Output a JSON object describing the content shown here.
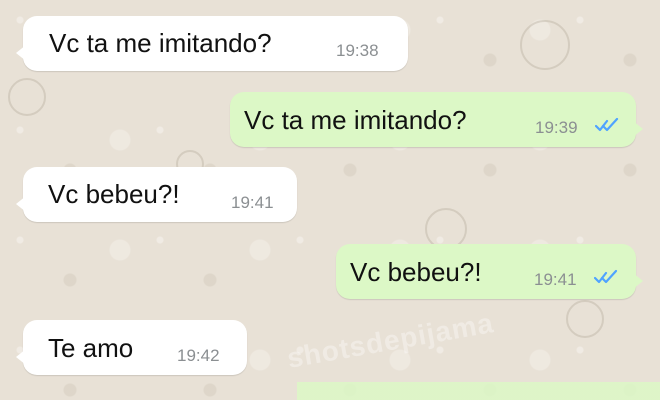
{
  "messages": [
    {
      "direction": "incoming",
      "text": "Vc ta me imitando?",
      "time": "19:38"
    },
    {
      "direction": "outgoing",
      "text": "Vc ta me imitando?",
      "time": "19:39",
      "status_icon": "double-check-icon",
      "status_color": "#4fa3ff"
    },
    {
      "direction": "incoming",
      "text": "Vc bebeu?!",
      "time": "19:41"
    },
    {
      "direction": "outgoing",
      "text": "Vc bebeu?!",
      "time": "19:41",
      "status_icon": "double-check-icon",
      "status_color": "#4fa3ff"
    },
    {
      "direction": "incoming",
      "text": "Te amo",
      "time": "19:42"
    }
  ],
  "watermark": {
    "text": "shotsdepijama"
  },
  "colors": {
    "incoming_bubble": "#ffffff",
    "outgoing_bubble": "#dcf8c6",
    "background": "#e8e1d6"
  }
}
